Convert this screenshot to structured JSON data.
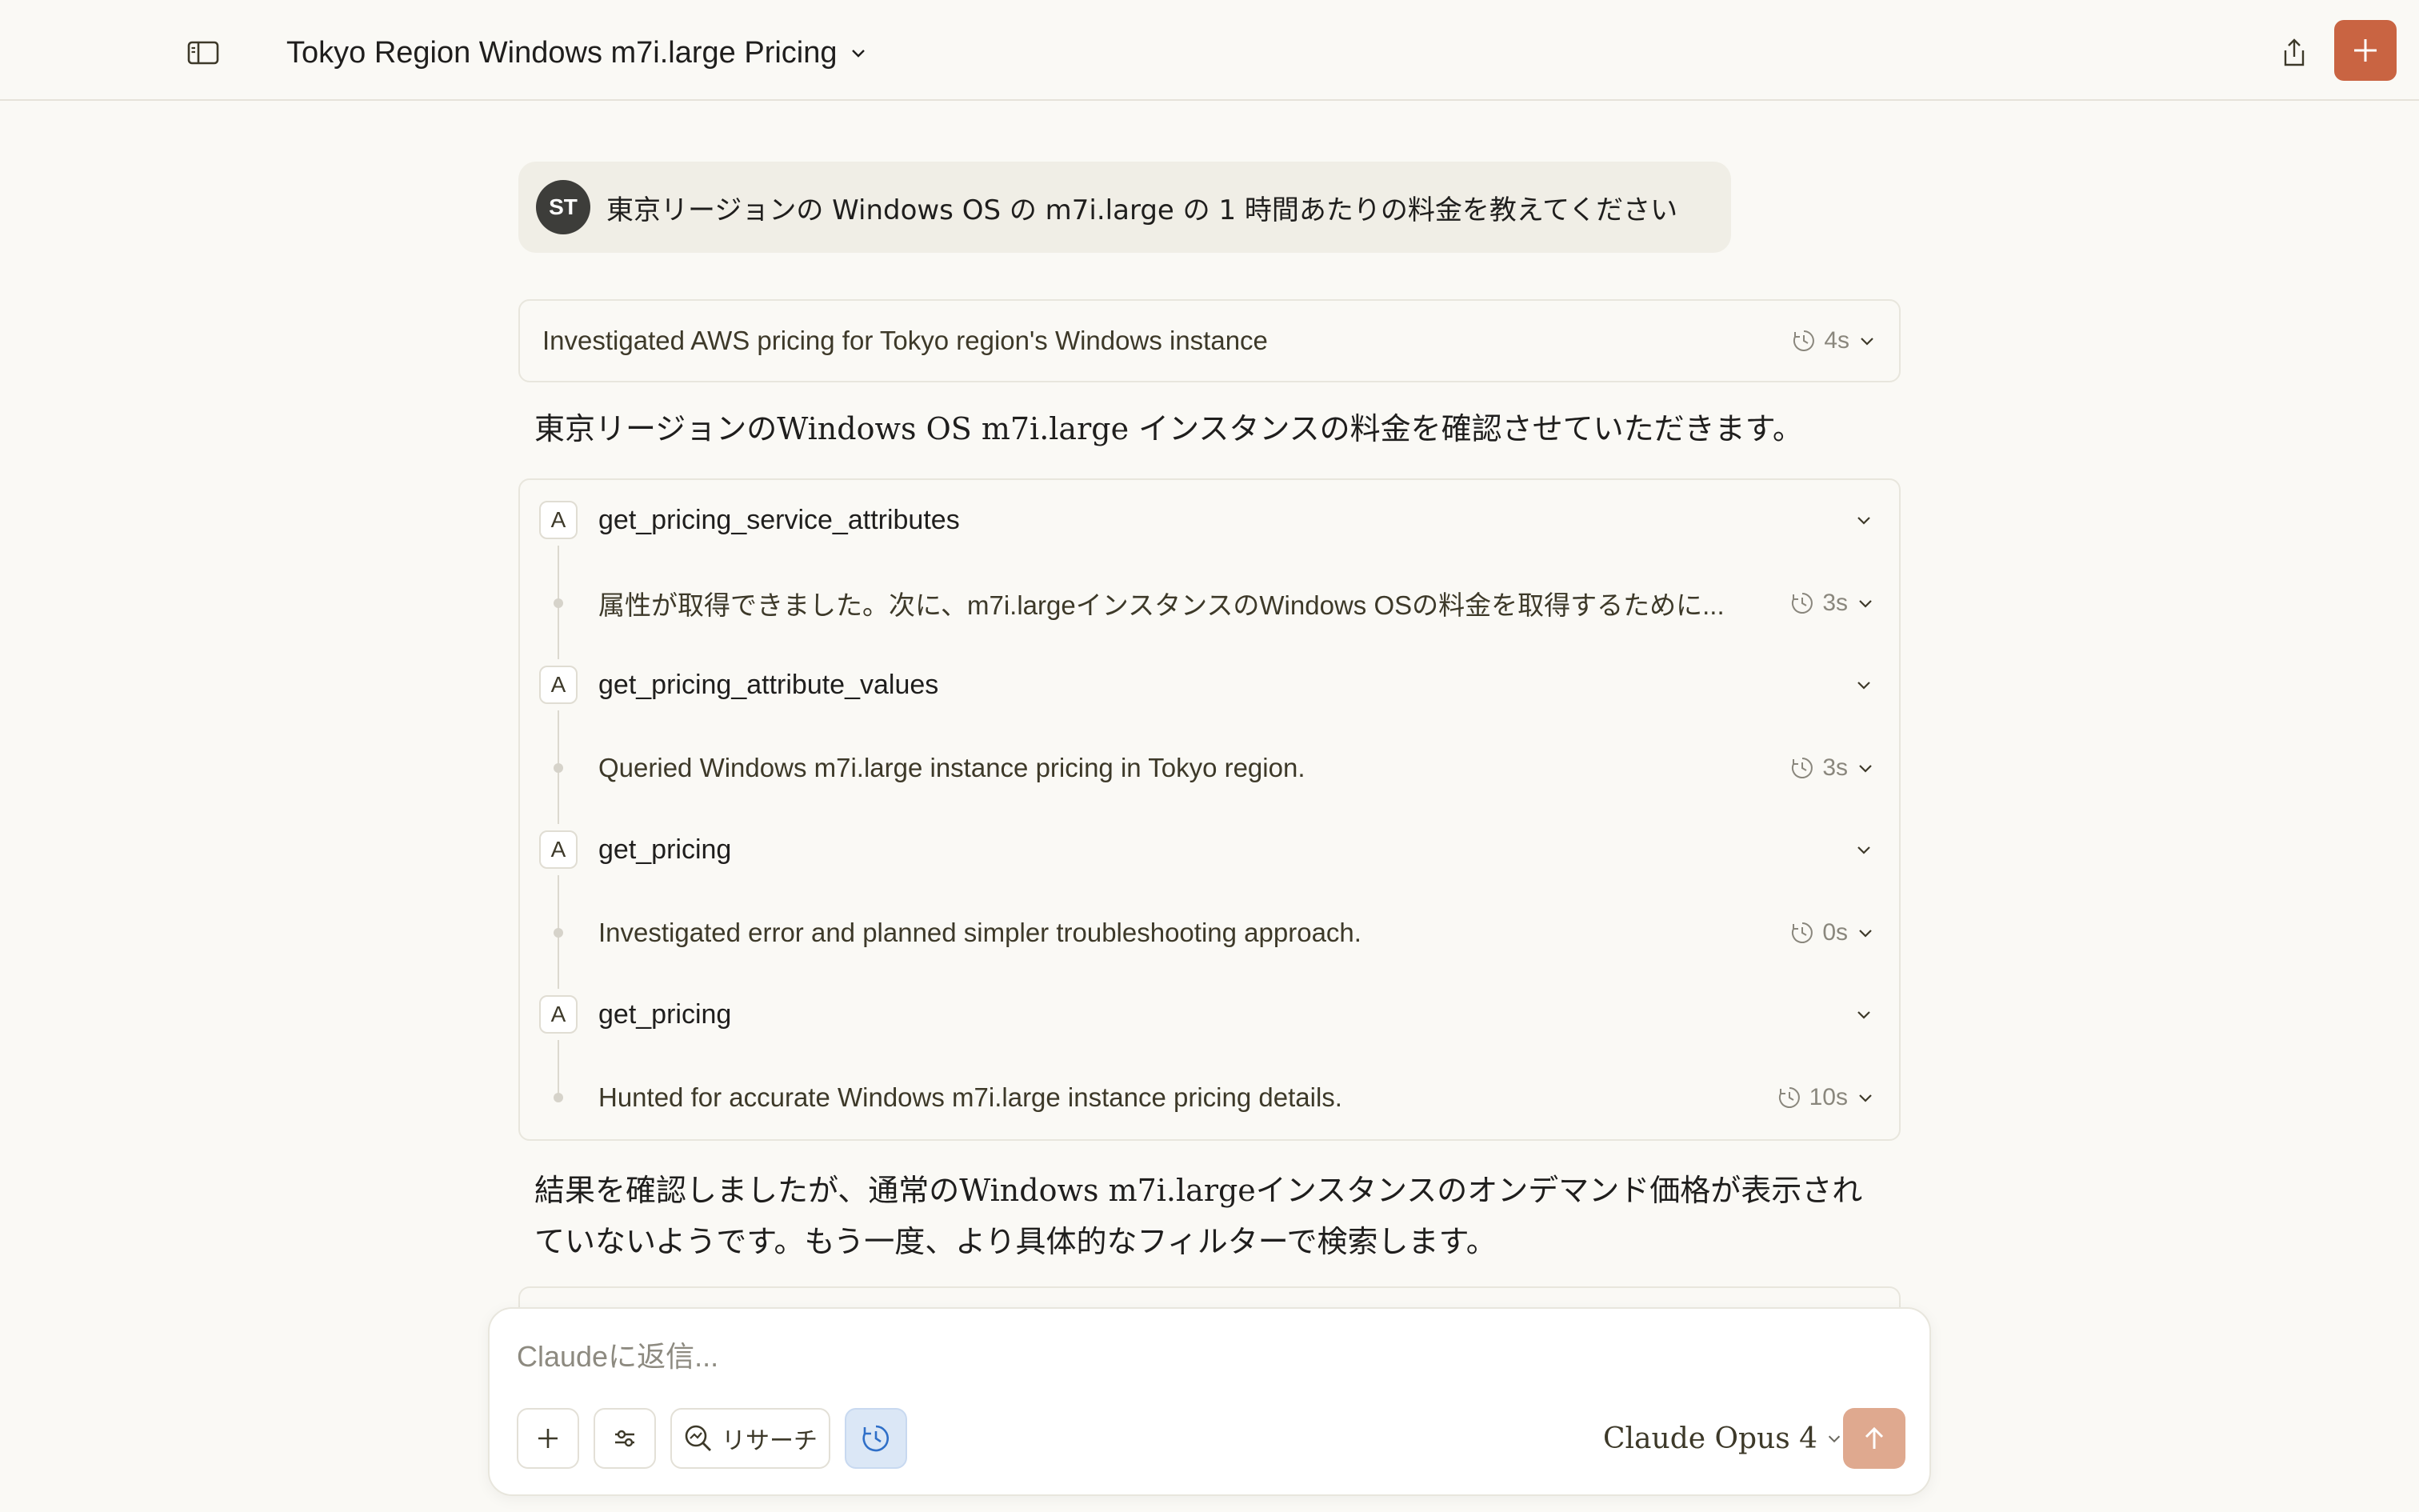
{
  "header": {
    "title": "Tokyo Region Windows m7i.large Pricing",
    "sidebar_icon": "sidebar-toggle-icon",
    "share_icon": "share-icon",
    "new_chat_icon": "plus-icon"
  },
  "colors": {
    "accent": "#c96442",
    "send_disabled": "#dfa98f",
    "background": "#faf9f5",
    "user_bubble": "#f0eee6"
  },
  "user_message": {
    "avatar_initials": "ST",
    "text": "東京リージョンの Windows OS の m7i.large の 1 時間あたりの料金を教えてください"
  },
  "thinking": {
    "text": "Investigated AWS pricing for Tokyo region's Windows instance",
    "duration": "4s"
  },
  "intro_paragraph": "東京リージョンのWindows OS m7i.large インスタンスの料金を確認させていただきます。",
  "tool_calls": [
    {
      "badge": "A",
      "name": "get_pricing_service_attributes",
      "step_text": "属性が取得できました。次に、m7i.largeインスタンスのWindows OSの料金を取得するために...",
      "step_duration": "3s"
    },
    {
      "badge": "A",
      "name": "get_pricing_attribute_values",
      "step_text": "Queried Windows m7i.large instance pricing in Tokyo region.",
      "step_duration": "3s"
    },
    {
      "badge": "A",
      "name": "get_pricing",
      "step_text": "Investigated error and planned simpler troubleshooting approach.",
      "step_duration": "0s"
    },
    {
      "badge": "A",
      "name": "get_pricing",
      "step_text": "Hunted for accurate Windows m7i.large instance pricing details.",
      "step_duration": "10s"
    }
  ],
  "result_paragraph": {
    "line1": "結果を確認しましたが、通常のWindows m7i.largeインスタンスのオンデマンド価格が表示され",
    "line2": "ていないようです。もう一度、より具体的なフィルターで検索します。"
  },
  "composer": {
    "placeholder": "Claudeに返信...",
    "research_label": "リサーチ",
    "model": "Claude Opus 4"
  }
}
